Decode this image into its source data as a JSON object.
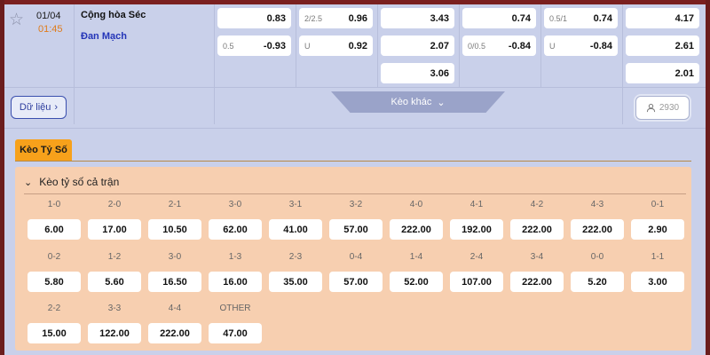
{
  "match": {
    "date": "01/04",
    "time": "01:45",
    "home_team": "Cộng hòa Séc",
    "away_team": "Đan Mạch",
    "star_icon": "star-icon"
  },
  "odds": {
    "col1": [
      {
        "label": "",
        "value": "0.83"
      },
      {
        "label": "0.5",
        "value": "-0.93"
      }
    ],
    "col2": [
      {
        "label": "2/2.5",
        "value": "0.96"
      },
      {
        "label": "U",
        "value": "0.92"
      }
    ],
    "col3": [
      {
        "label": "",
        "value": "3.43"
      },
      {
        "label": "",
        "value": "2.07"
      },
      {
        "label": "",
        "value": "3.06"
      }
    ],
    "col4": [
      {
        "label": "",
        "value": "0.74"
      },
      {
        "label": "0/0.5",
        "value": "-0.84"
      }
    ],
    "col5": [
      {
        "label": "0.5/1",
        "value": "0.74"
      },
      {
        "label": "U",
        "value": "-0.84"
      }
    ],
    "col6": [
      {
        "label": "",
        "value": "4.17"
      },
      {
        "label": "",
        "value": "2.61"
      },
      {
        "label": "",
        "value": "2.01"
      }
    ]
  },
  "controls": {
    "data_button": "Dữ liệu",
    "other_odds": "Kèo khác",
    "viewers": "2930"
  },
  "tab": {
    "label": "Kèo Tỷ Số"
  },
  "scores": {
    "title": "Kèo tỷ số cả trận",
    "rows": [
      [
        {
          "score": "1-0",
          "odd": "6.00"
        },
        {
          "score": "2-0",
          "odd": "17.00"
        },
        {
          "score": "2-1",
          "odd": "10.50"
        },
        {
          "score": "3-0",
          "odd": "62.00"
        },
        {
          "score": "3-1",
          "odd": "41.00"
        },
        {
          "score": "3-2",
          "odd": "57.00"
        },
        {
          "score": "4-0",
          "odd": "222.00"
        },
        {
          "score": "4-1",
          "odd": "192.00"
        },
        {
          "score": "4-2",
          "odd": "222.00"
        },
        {
          "score": "4-3",
          "odd": "222.00"
        },
        {
          "score": "0-1",
          "odd": "2.90"
        }
      ],
      [
        {
          "score": "0-2",
          "odd": "5.80"
        },
        {
          "score": "1-2",
          "odd": "5.60"
        },
        {
          "score": "3-0",
          "odd": "16.50"
        },
        {
          "score": "1-3",
          "odd": "16.00"
        },
        {
          "score": "2-3",
          "odd": "35.00"
        },
        {
          "score": "0-4",
          "odd": "57.00"
        },
        {
          "score": "1-4",
          "odd": "52.00"
        },
        {
          "score": "2-4",
          "odd": "107.00"
        },
        {
          "score": "3-4",
          "odd": "222.00"
        },
        {
          "score": "0-0",
          "odd": "5.20"
        },
        {
          "score": "1-1",
          "odd": "3.00"
        }
      ],
      [
        {
          "score": "2-2",
          "odd": "15.00"
        },
        {
          "score": "3-3",
          "odd": "122.00"
        },
        {
          "score": "4-4",
          "odd": "222.00"
        },
        {
          "score": "OTHER",
          "odd": "47.00"
        }
      ]
    ]
  }
}
